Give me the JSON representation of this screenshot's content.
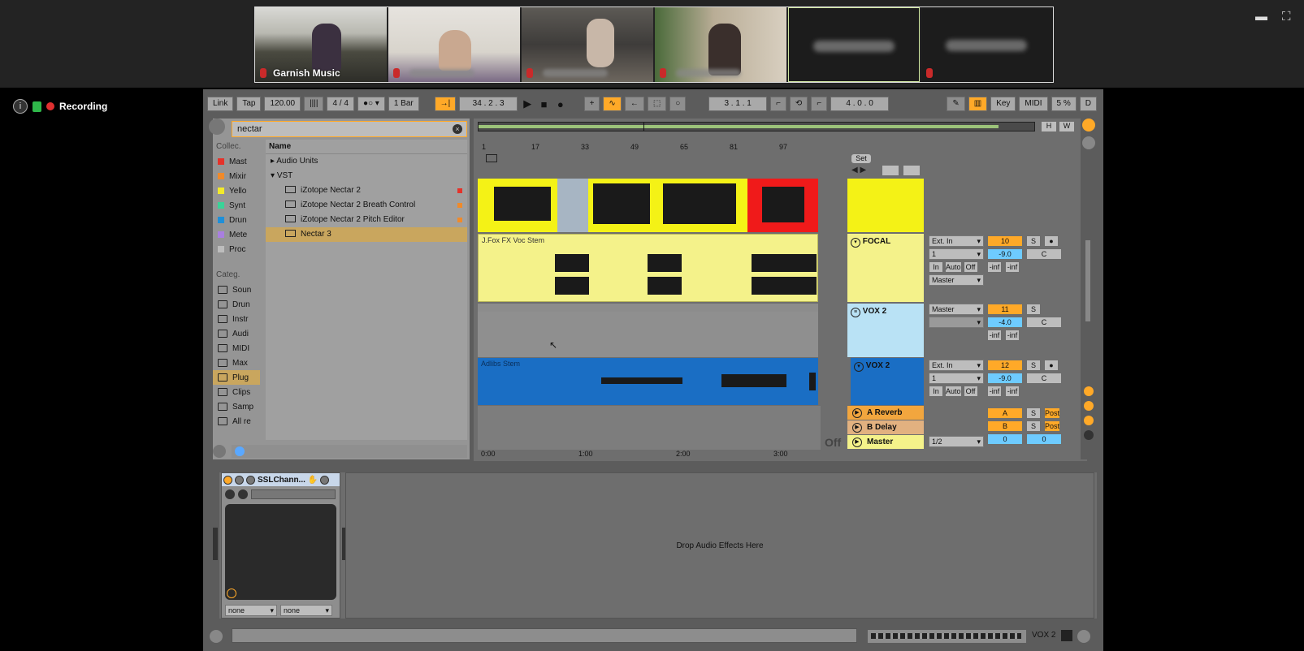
{
  "meeting": {
    "participants": [
      {
        "name": "Garnish Music",
        "blurred": false
      },
      {
        "name": "",
        "blurred": true
      },
      {
        "name": "",
        "blurred": true
      },
      {
        "name": "",
        "blurred": true
      },
      {
        "name": "",
        "blurred": true
      },
      {
        "name": "",
        "blurred": true
      }
    ],
    "recording_label": "Recording",
    "info_icon": "i"
  },
  "transport": {
    "link": "Link",
    "tap": "Tap",
    "tempo": "120.00",
    "signature": "4 / 4",
    "quantize": "1 Bar",
    "position": "34 .  2 .  3",
    "loop_start": "3 .  1 .  1",
    "loop_length": "4 .  0 .  0",
    "key": "Key",
    "midi": "MIDI",
    "cpu": "5 %",
    "d": "D"
  },
  "browser": {
    "search_value": "nectar",
    "collections_header": "Collec.",
    "collections": [
      {
        "label": "Mast",
        "color": "#e5322a"
      },
      {
        "label": "Mixir",
        "color": "#f08a2a"
      },
      {
        "label": "Yello",
        "color": "#f2ea2a"
      },
      {
        "label": "Synt",
        "color": "#3ad398"
      },
      {
        "label": "Drun",
        "color": "#1f8fd8"
      },
      {
        "label": "Mete",
        "color": "#a97fe0"
      },
      {
        "label": "Proc",
        "color": "#bdbdbd"
      }
    ],
    "categories_header": "Categ.",
    "categories": [
      "Soun",
      "Drun",
      "Instr",
      "Audi",
      "MIDI",
      "Max",
      "Plug",
      "Clips",
      "Samp",
      "All re"
    ],
    "results_header": "Name",
    "results": [
      {
        "label": "Audio Units",
        "type": "folder",
        "expanded": false
      },
      {
        "label": "VST",
        "type": "folder",
        "expanded": true
      },
      {
        "label": "iZotope Nectar 2",
        "type": "plugin",
        "dot": "#e5322a"
      },
      {
        "label": "iZotope Nectar 2 Breath Control",
        "type": "plugin",
        "dot": "#f08a2a"
      },
      {
        "label": "iZotope Nectar 2 Pitch Editor",
        "type": "plugin",
        "dot": "#f08a2a"
      },
      {
        "label": "Nectar 3",
        "type": "plugin",
        "selected": true
      }
    ]
  },
  "arrangement": {
    "ruler_ticks": [
      "1",
      "17",
      "33",
      "49",
      "65",
      "81",
      "97"
    ],
    "time_ticks": [
      "0:00",
      "1:00",
      "2:00",
      "3:00"
    ],
    "set_label": "Set",
    "off_label": "Off",
    "clips": {
      "focal_clip": "J.Fox FX Voc Stem",
      "vox2_clip": "Adlibs Stem"
    }
  },
  "tracks": [
    {
      "name": "FOCAL",
      "color": "#f4f28a",
      "input": "Ext. In",
      "channel": "1",
      "output": "Master",
      "number": "10",
      "volume": "-9.0",
      "pan": "C",
      "in": "In",
      "auto": "Auto",
      "off": "Off",
      "peak1": "-inf",
      "peak2": "-inf"
    },
    {
      "name": "VOX 2",
      "color": "#b9e2f5",
      "output": "Master",
      "number": "11",
      "volume": "-4.0",
      "pan": "C",
      "peak1": "-inf",
      "peak2": "-inf"
    },
    {
      "name": "VOX 2",
      "color": "#1a6ec4",
      "input": "Ext. In",
      "channel": "1",
      "number": "12",
      "volume": "-9.0",
      "pan": "C",
      "in": "In",
      "auto": "Auto",
      "off": "Off",
      "peak1": "-inf",
      "peak2": "-inf",
      "extra": "VOX 2"
    }
  ],
  "returns": [
    {
      "name": "A Reverb",
      "letter": "A",
      "post": "Post",
      "color": "#f2a63e"
    },
    {
      "name": "B Delay",
      "letter": "B",
      "post": "Post",
      "color": "#e2b180"
    },
    {
      "name": "Master",
      "routing": "1/2",
      "color": "#f4f28a",
      "val1": "0",
      "val2": "0"
    }
  ],
  "solo": "S",
  "device": {
    "title": "SSLChann...",
    "sel1": "none",
    "sel2": "none",
    "drop_text": "Drop Audio Effects Here"
  },
  "status": {
    "track_label": "VOX 2"
  },
  "colors": {
    "accent": "#ffa928",
    "blue": "#6ecbff"
  }
}
